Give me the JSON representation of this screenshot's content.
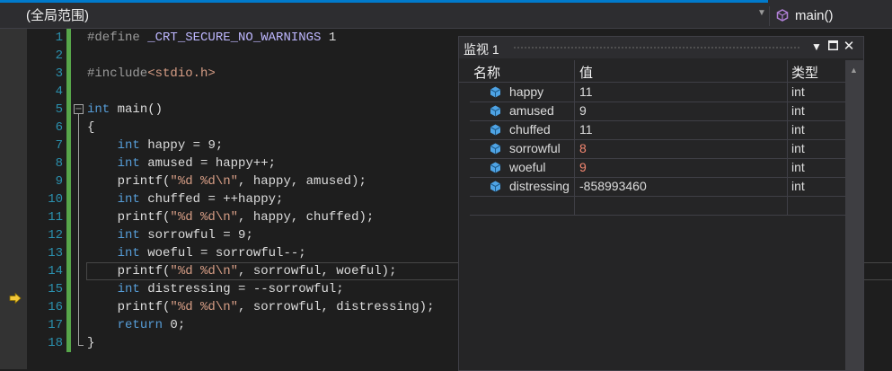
{
  "nav": {
    "scope": "(全局范围)",
    "function": "main()"
  },
  "code_lines": [
    {
      "num": "1",
      "html": "<span class='pre'>#define</span> <span class='mac'>_CRT_SECURE_NO_WARNINGS</span> 1"
    },
    {
      "num": "2",
      "html": ""
    },
    {
      "num": "3",
      "html": "<span class='pre'>#include</span><span class='inc'>&lt;stdio.h&gt;</span>"
    },
    {
      "num": "4",
      "html": ""
    },
    {
      "num": "5",
      "html": "<span class='kw'>int</span> main()"
    },
    {
      "num": "6",
      "html": "{"
    },
    {
      "num": "7",
      "html": "    <span class='kw'>int</span> happy = 9;"
    },
    {
      "num": "8",
      "html": "    <span class='kw'>int</span> amused = happy++;"
    },
    {
      "num": "9",
      "html": "    printf(<span class='str'>\"%d %d\\n\"</span>, happy, amused);"
    },
    {
      "num": "10",
      "html": "    <span class='kw'>int</span> chuffed = ++happy;"
    },
    {
      "num": "11",
      "html": "    printf(<span class='str'>\"%d %d\\n\"</span>, happy, chuffed);"
    },
    {
      "num": "12",
      "html": "    <span class='kw'>int</span> sorrowful = 9;"
    },
    {
      "num": "13",
      "html": "    <span class='kw'>int</span> woeful = sorrowful--;"
    },
    {
      "num": "14",
      "html": "    printf(<span class='str'>\"%d %d\\n\"</span>, sorrowful, woeful);"
    },
    {
      "num": "15",
      "html": "    <span class='kw'>int</span> distressing = --sorrowful;"
    },
    {
      "num": "16",
      "html": "    printf(<span class='str'>\"%d %d\\n\"</span>, sorrowful, distressing);"
    },
    {
      "num": "17",
      "html": "    <span class='kw'>return</span> 0;"
    },
    {
      "num": "18",
      "html": "}"
    }
  ],
  "watch": {
    "title": "监视 1",
    "headers": {
      "name": "名称",
      "value": "值",
      "type": "类型"
    },
    "rows": [
      {
        "name": "happy",
        "value": "11",
        "type": "int",
        "changed": false
      },
      {
        "name": "amused",
        "value": "9",
        "type": "int",
        "changed": false
      },
      {
        "name": "chuffed",
        "value": "11",
        "type": "int",
        "changed": false
      },
      {
        "name": "sorrowful",
        "value": "8",
        "type": "int",
        "changed": true
      },
      {
        "name": "woeful",
        "value": "9",
        "type": "int",
        "changed": true
      },
      {
        "name": "distressing",
        "value": "-858993460",
        "type": "int",
        "changed": false
      }
    ]
  },
  "colors": {
    "changed_value": "#f48771",
    "normal_value": "#dcdcdc",
    "watch_icon": "#4ea3e4"
  },
  "icons": {
    "function": "cube-icon",
    "breakpoint": "current-statement-arrow-icon",
    "watch_var": "variable-cube-icon"
  }
}
